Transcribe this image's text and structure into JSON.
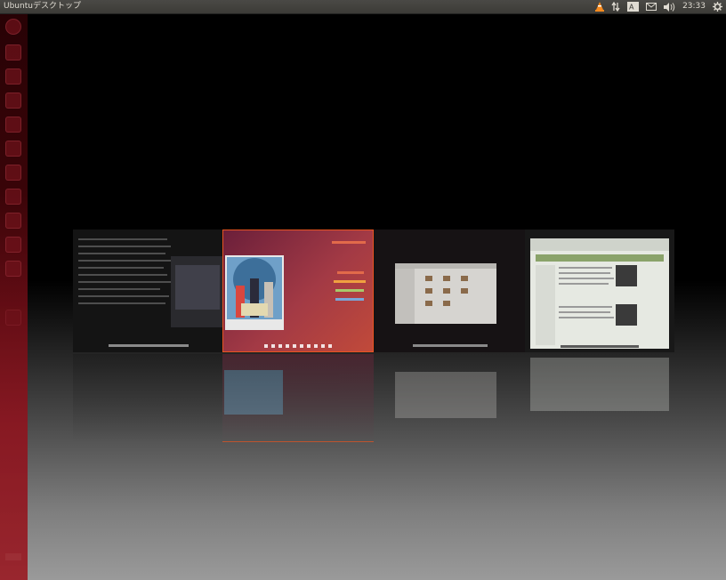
{
  "panel": {
    "title": "Ubuntuデスクトップ",
    "clock": "23:33",
    "indicators": [
      "vlc-cone-icon",
      "network-updown-icon",
      "keyboard-input-icon",
      "mail-icon",
      "volume-icon",
      "gear-icon"
    ],
    "keyboard_label": "A"
  },
  "colors": {
    "launcher": "#8a1620",
    "panel": "#3c3b37",
    "accent": "#e95420",
    "selected_border": "#e95420"
  },
  "launcher": {
    "icons": [
      "dash-home-icon",
      "files-icon",
      "browser-icon",
      "writer-icon",
      "calc-icon",
      "impress-icon",
      "software-center-icon",
      "home-folder-icon",
      "system-settings-icon",
      "workspace-icon",
      "trash-icon"
    ]
  },
  "switcher": {
    "windows": [
      {
        "name": "terminal-window",
        "selected": false
      },
      {
        "name": "image-viewer-window",
        "selected": true
      },
      {
        "name": "file-manager-window",
        "selected": false
      },
      {
        "name": "web-browser-window",
        "selected": false
      }
    ]
  }
}
